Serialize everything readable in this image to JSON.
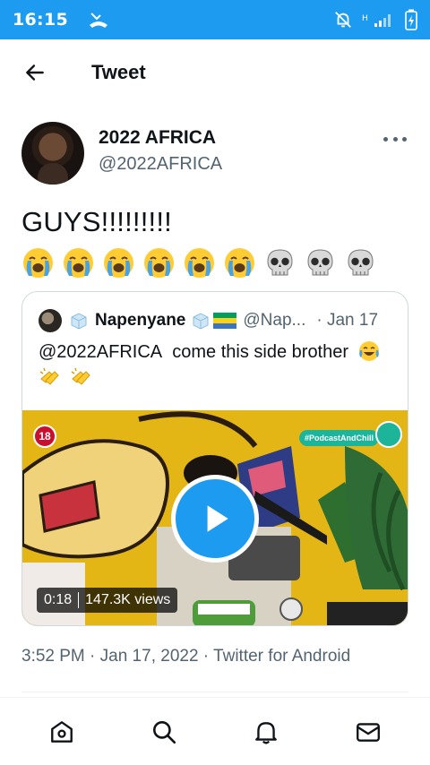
{
  "status_bar": {
    "time": "16:15",
    "background": "#1d9bf0"
  },
  "header": {
    "title": "Tweet"
  },
  "tweet": {
    "author_name": "2022 AFRICA",
    "author_handle": "@2022AFRICA",
    "text": "GUYS!!!!!!!!!",
    "emojis": [
      "loudly-crying-face",
      "loudly-crying-face",
      "loudly-crying-face",
      "loudly-crying-face",
      "loudly-crying-face",
      "loudly-crying-face",
      "skull",
      "skull",
      "skull"
    ],
    "timestamp": "3:52 PM · Jan 17, 2022 · Twitter for Android"
  },
  "quote": {
    "author_name": "Napenyane",
    "author_handle": "@Nap...",
    "date": "· Jan 17",
    "text_mention": "@2022AFRICA",
    "text_body": "come this side brother",
    "video": {
      "rating_badge": "18",
      "tag": "#PodcastAndChill",
      "duration": "0:18",
      "views": "147.3K views"
    }
  },
  "colors": {
    "accent": "#1d9bf0",
    "secondary_text": "#536471",
    "video_bg": "#e3b515"
  },
  "bottom_nav": [
    "home-icon",
    "search-icon",
    "notifications-icon",
    "messages-icon"
  ]
}
